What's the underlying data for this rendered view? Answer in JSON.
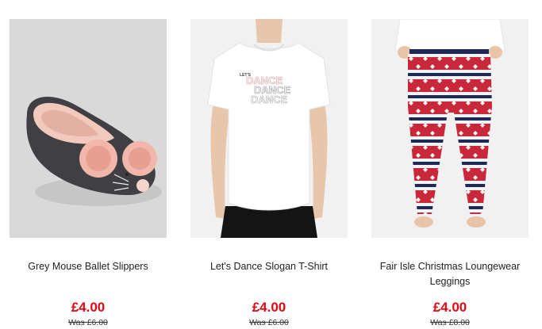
{
  "colors": {
    "price": "#e30613",
    "text": "#222222",
    "image_bg_gray": "#d9d9d9",
    "image_bg_light": "#f1f1f1"
  },
  "products": [
    {
      "name": "Grey Mouse Ballet Slippers",
      "price": "£4.00",
      "was_price": "Was £6.00",
      "image": "grey-mouse-slipper"
    },
    {
      "name": "Let's Dance Slogan T-Shirt",
      "price": "£4.00",
      "was_price": "Was £6.00",
      "image": "white-slogan-tshirt",
      "slogan_lines": [
        "LET'S",
        "DANCE",
        "DANCE",
        "DANCE"
      ]
    },
    {
      "name": "Fair Isle Christmas Loungewear Leggings",
      "price": "£4.00",
      "was_price": "Was £8.00",
      "image": "fair-isle-leggings"
    }
  ]
}
